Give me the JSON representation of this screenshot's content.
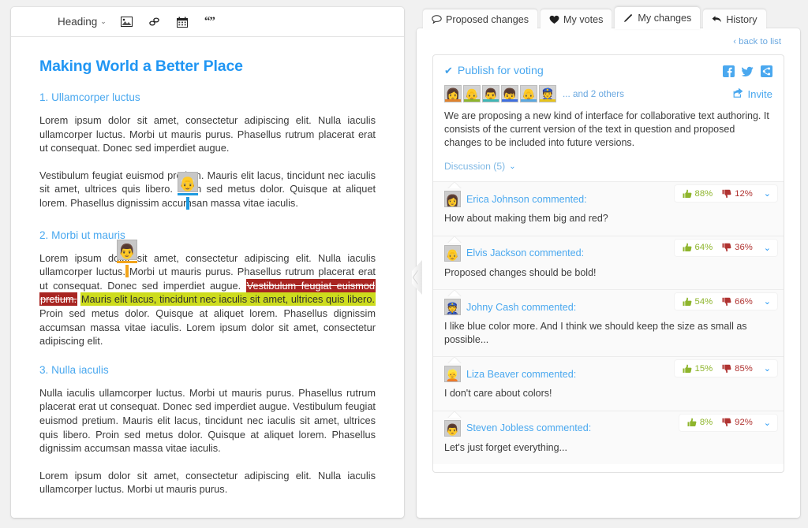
{
  "editor": {
    "toolbar": {
      "heading_label": "Heading",
      "heading_caret": "⌄",
      "image_icon": "image-icon",
      "link_icon": "link-icon",
      "table_icon": "calendar-table-icon",
      "quote_label": "“”"
    },
    "title": "Making World a Better Place",
    "sections": [
      {
        "heading": "1. Ullamcorper luctus",
        "paragraphs": [
          "Lorem ipsum dolor sit amet, consectetur adipiscing elit. Nulla iaculis ullamcorper luctus. Morbi ut mauris purus. Phasellus rutrum placerat erat ut consequat. Donec sed imperdiet augue.",
          "Vestibulum feugiat euismod pretium. Mauris elit lacus, tincidunt nec iaculis sit amet, ultrices quis libero. Proin sed metus dolor. Quisque at aliquet lorem. Phasellus dignissim accumsan massa vitae iaculis."
        ]
      },
      {
        "heading": "2. Morbi ut mauris",
        "before_text": "Lorem ipsum dolor sit amet, consectetur adipiscing elit. Nulla iaculis ullamcorper luctus. Morbi ut mauris purus. Phasellus rutrum placerat erat ut consequat. Donec sed imperdiet augue. ",
        "deleted_text": "Vestibulum feugiat euismod pretium.",
        "inserted_text": "Mauris elit lacus, tincidunt nec iaculis sit amet, ultrices quis libero.",
        "after_text": " Proin sed metus dolor. Quisque at aliquet lorem. Phasellus dignissim accumsan massa vitae iaculis. Lorem ipsum dolor sit amet, consectetur adipiscing elit."
      },
      {
        "heading": "3. Nulla iaculis",
        "paragraphs": [
          "Nulla iaculis ullamcorper luctus. Morbi ut mauris purus. Phasellus rutrum placerat erat ut consequat. Donec sed imperdiet augue. Vestibulum feugiat euismod pretium. Mauris elit lacus, tincidunt nec iaculis sit amet, ultrices quis libero. Proin sed metus dolor. Quisque at aliquet lorem. Phasellus dignissim accumsan massa vitae iaculis.",
          "Lorem ipsum dolor sit amet, consectetur adipiscing elit. Nulla iaculis ullamcorper luctus. Morbi ut mauris purus."
        ]
      }
    ],
    "cursors": [
      {
        "name": "cursor-blue",
        "glyph": "👴",
        "color": "#1e9ae0"
      },
      {
        "name": "cursor-orange",
        "glyph": "👨",
        "color": "#f2a41a"
      }
    ]
  },
  "collapse_handle": {
    "icon": "chevron-left-icon"
  },
  "tabs": [
    {
      "label": "Proposed changes",
      "icon": "speech-bubble-icon",
      "glyph": "⌽",
      "active": false
    },
    {
      "label": "My votes",
      "icon": "heart-icon",
      "glyph": "♥",
      "active": false
    },
    {
      "label": "My changes",
      "icon": "pencil-icon",
      "glyph": "✎",
      "active": true
    },
    {
      "label": "History",
      "icon": "undo-arrow-icon",
      "glyph": "↩",
      "active": false
    }
  ],
  "panel": {
    "back_to_list": "‹ back to list",
    "publish_label": "Publish for voting",
    "check_glyph": "✔",
    "social": [
      {
        "name": "facebook-icon",
        "color": "#4aa8ef"
      },
      {
        "name": "twitter-icon",
        "color": "#4aa8ef"
      },
      {
        "name": "share-icon",
        "color": "#4aa8ef"
      }
    ],
    "avatars": [
      {
        "glyph": "👩",
        "bar": "#e0822c"
      },
      {
        "glyph": "👴",
        "bar": "#8eb52c"
      },
      {
        "glyph": "👨",
        "bar": "#3fb6b6"
      },
      {
        "glyph": "👦",
        "bar": "#3f6fe0"
      },
      {
        "glyph": "👴",
        "bar": "#5ba8e0"
      },
      {
        "glyph": "👮",
        "bar": "#e8c41a"
      }
    ],
    "others_label": "... and 2 others",
    "invite_label": "Invite",
    "invite_icon": "invite-share-icon",
    "description": "We are proposing a new kind of interface for collaborative text authoring. It consists of the current version of the text in question and proposed changes to be included into future versions.",
    "discussion_label": "Discussion (5)",
    "discussion_caret": "⌄"
  },
  "comments": [
    {
      "avatar_glyph": "👩",
      "author": "Erica Johnson commented:",
      "text": "How about making them big and red?",
      "up": "88%",
      "down": "12%"
    },
    {
      "avatar_glyph": "👴",
      "author": "Elvis Jackson commented:",
      "text": "Proposed changes should be bold!",
      "up": "64%",
      "down": "36%"
    },
    {
      "avatar_glyph": "👮",
      "author": "Johny Cash commented:",
      "text": "I like blue color more. And I think we should keep the size as small as possible...",
      "up": "54%",
      "down": "66%"
    },
    {
      "avatar_glyph": "👱",
      "author": "Liza Beaver commented:",
      "text": "I don't care about colors!",
      "up": "15%",
      "down": "85%"
    },
    {
      "avatar_glyph": "👨",
      "author": "Steven Jobless commented:",
      "text": "Let's just forget everything...",
      "up": "8%",
      "down": "92%"
    }
  ],
  "colors": {
    "accent_blue": "#2196f3",
    "link_blue": "#4aa8ef",
    "delete_red": "#a82521",
    "insert_green": "#cddc1d",
    "vote_up_green": "#8eb52c",
    "vote_down_red": "#b03331",
    "page_bg": "#f1f1f1"
  }
}
